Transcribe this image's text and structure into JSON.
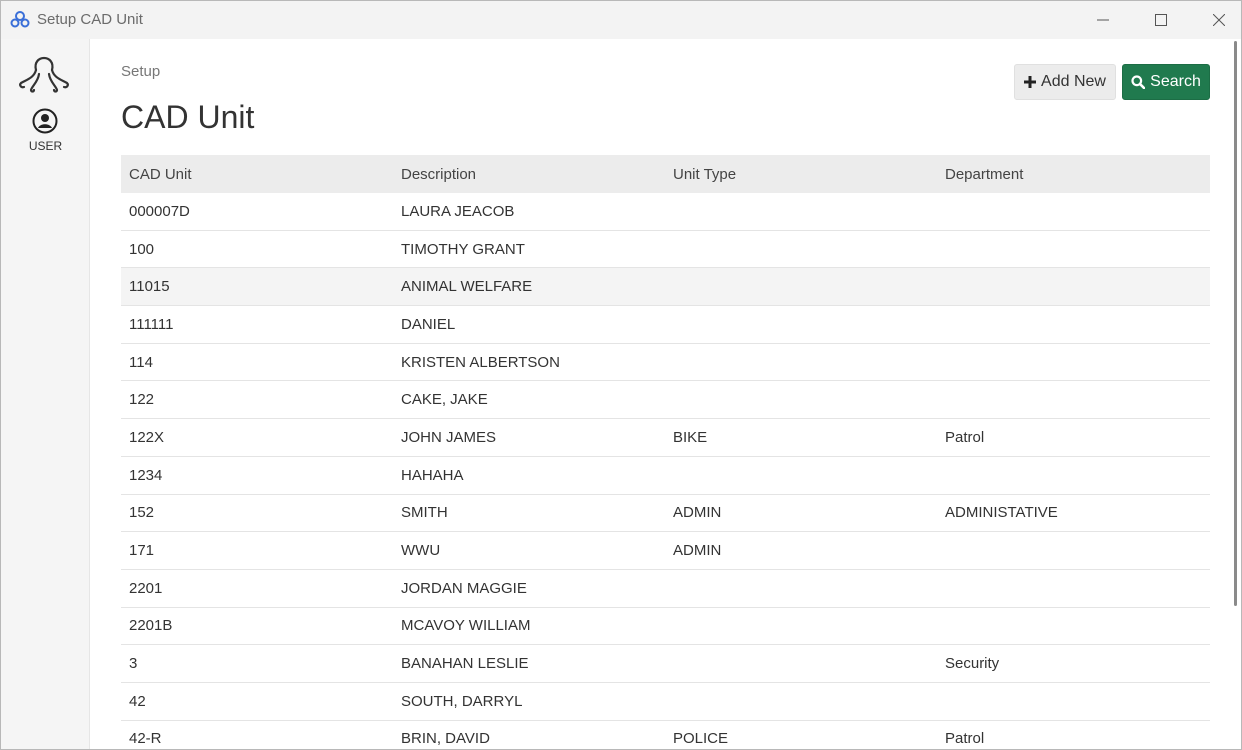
{
  "window": {
    "title": "Setup CAD Unit",
    "icons": {
      "app": "app-logo-icon",
      "minimize": "minimize-icon",
      "maximize": "maximize-icon",
      "close": "close-icon"
    }
  },
  "sidebar": {
    "logo_icon": "octopus-logo-icon",
    "user_icon": "user-circle-icon",
    "user_label": "USER"
  },
  "main": {
    "breadcrumb": "Setup",
    "title": "CAD Unit",
    "add_new_label": "Add New",
    "search_label": "Search",
    "colors": {
      "search_button": "#207a4e",
      "header_bg": "#ececec"
    }
  },
  "table": {
    "columns": [
      "CAD Unit",
      "Description",
      "Unit Type",
      "Department"
    ],
    "rows": [
      [
        "000007D",
        "LAURA JEACOB",
        "",
        ""
      ],
      [
        "100",
        "TIMOTHY GRANT",
        "",
        ""
      ],
      [
        "11015",
        "ANIMAL WELFARE",
        "",
        ""
      ],
      [
        "111111",
        "DANIEL",
        "",
        ""
      ],
      [
        "114",
        "KRISTEN ALBERTSON",
        "",
        ""
      ],
      [
        "122",
        "CAKE, JAKE",
        "",
        ""
      ],
      [
        "122X",
        "JOHN JAMES",
        "BIKE",
        "Patrol"
      ],
      [
        "1234",
        "HAHAHA",
        "",
        ""
      ],
      [
        "152",
        "SMITH",
        "ADMIN",
        "ADMINISTATIVE"
      ],
      [
        "171",
        "WWU",
        "ADMIN",
        ""
      ],
      [
        "2201",
        "JORDAN MAGGIE",
        "",
        ""
      ],
      [
        "2201B",
        "MCAVOY WILLIAM",
        "",
        ""
      ],
      [
        "3",
        "BANAHAN LESLIE",
        "",
        "Security"
      ],
      [
        "42",
        "SOUTH, DARRYL",
        "",
        ""
      ],
      [
        "42-R",
        "BRIN, DAVID",
        "POLICE",
        "Patrol"
      ]
    ]
  }
}
